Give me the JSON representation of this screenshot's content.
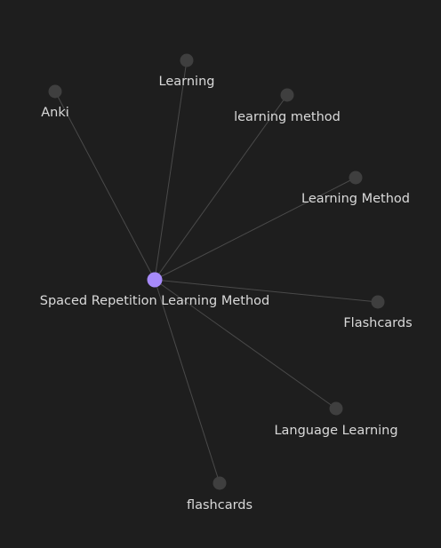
{
  "graph": {
    "center": {
      "label": "Spaced Repetition Learning Method",
      "color": "#a68af9"
    },
    "nodes": [
      {
        "label": "Anki"
      },
      {
        "label": "Learning"
      },
      {
        "label": "learning method"
      },
      {
        "label": "Learning Method"
      },
      {
        "label": "Flashcards"
      },
      {
        "label": "Language Learning"
      },
      {
        "label": "flashcards"
      }
    ],
    "node_color": "#3f3f3f",
    "edge_color": "#4a4a4a",
    "background": "#1e1e1e"
  }
}
